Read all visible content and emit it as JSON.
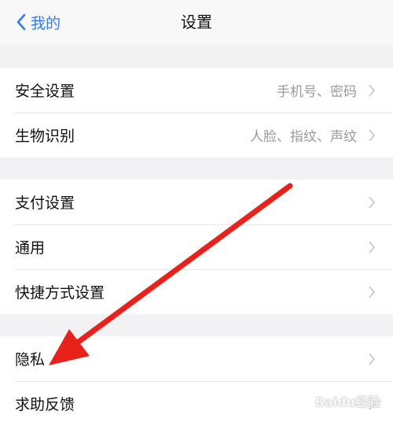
{
  "header": {
    "back_label": "我的",
    "title": "设置"
  },
  "groups": [
    {
      "items": [
        {
          "label": "安全设置",
          "value": "手机号、密码"
        },
        {
          "label": "生物识别",
          "value": "人脸、指纹、声纹"
        }
      ]
    },
    {
      "items": [
        {
          "label": "支付设置",
          "value": ""
        },
        {
          "label": "通用",
          "value": ""
        },
        {
          "label": "快捷方式设置",
          "value": ""
        }
      ]
    },
    {
      "items": [
        {
          "label": "隐私",
          "value": ""
        },
        {
          "label": "求助反馈",
          "value": ""
        }
      ]
    }
  ],
  "annotation": {
    "arrow_color": "#e8211b"
  },
  "watermark": "Baidu经验",
  "colors": {
    "accent": "#2f7cf6",
    "background": "#f2f2f4"
  }
}
